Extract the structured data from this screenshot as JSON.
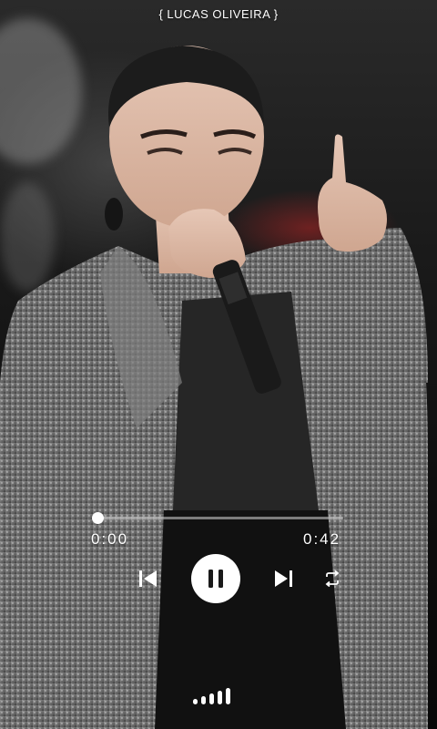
{
  "header": {
    "credit_text": "{ LUCAS OLIVEIRA }"
  },
  "player": {
    "elapsed": "0:00",
    "duration": "0:42",
    "progress_fraction": 0.0,
    "controls": {
      "previous_icon": "skip-previous-icon",
      "play_pause_icon": "pause-icon",
      "next_icon": "skip-next-icon",
      "repeat_icon": "repeat-icon"
    }
  },
  "footer": {
    "signal_icon": "signal-strength-icon",
    "signal_level": 5
  },
  "colors": {
    "controls": "#ffffff",
    "play_button_bg": "#ffffff",
    "play_button_icon": "#1a1a1a"
  }
}
